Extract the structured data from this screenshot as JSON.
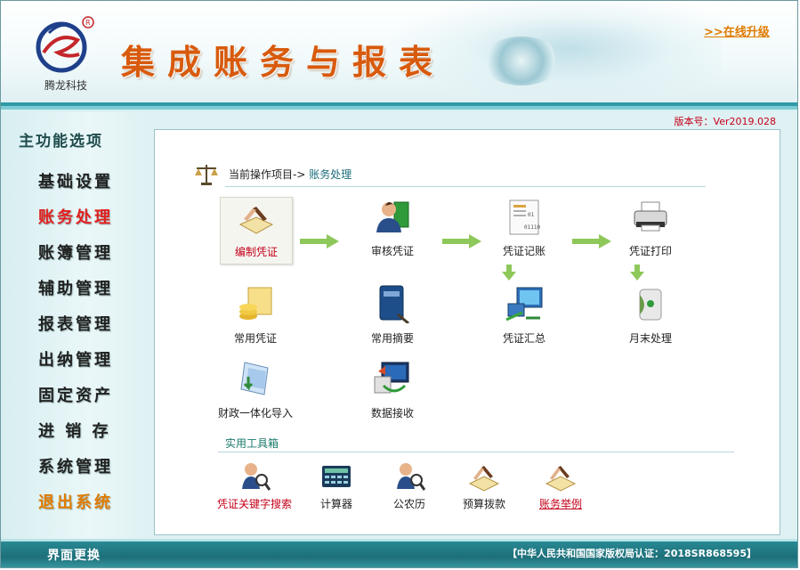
{
  "header": {
    "brand_name": "腾龙科技",
    "app_title": "集成账务与报表",
    "upgrade_link": ">>在线升级",
    "version": "版本号：Ver2019.028"
  },
  "sidebar": {
    "title": "主功能选项",
    "items": [
      {
        "label": "基础设置",
        "state": "normal"
      },
      {
        "label": "账务处理",
        "state": "active"
      },
      {
        "label": "账簿管理",
        "state": "normal"
      },
      {
        "label": "辅助管理",
        "state": "normal"
      },
      {
        "label": "报表管理",
        "state": "normal"
      },
      {
        "label": "出纳管理",
        "state": "normal"
      },
      {
        "label": "固定资产",
        "state": "normal"
      },
      {
        "label": "进 销 存",
        "state": "normal"
      },
      {
        "label": "系统管理",
        "state": "normal"
      },
      {
        "label": "退出系统",
        "state": "exit"
      }
    ]
  },
  "breadcrumb": {
    "prefix": "当前操作项目->",
    "current": "账务处理"
  },
  "functions": {
    "compile_voucher": "编制凭证",
    "review_voucher": "审核凭证",
    "post_voucher": "凭证记账",
    "print_voucher": "凭证打印",
    "common_voucher": "常用凭证",
    "common_summary": "常用摘要",
    "voucher_summary": "凭证汇总",
    "month_end": "月末处理",
    "finance_import": "财政一体化导入",
    "data_receive": "数据接收"
  },
  "toolbox": {
    "title": "实用工具箱",
    "keyword_search": "凭证关键字搜索",
    "calculator": "计算器",
    "calendar": "公农历",
    "budget": "预算拨款",
    "examples": "账务举例"
  },
  "footer": {
    "skin_change": "界面更换",
    "copyright": "【中华人民共和国国家版权局认证：2018SR868595】"
  },
  "colors": {
    "accent_teal": "#2f9aa7",
    "title_orange": "#d85a0c",
    "active_red": "#e02020",
    "link_orange": "#e07b00"
  }
}
